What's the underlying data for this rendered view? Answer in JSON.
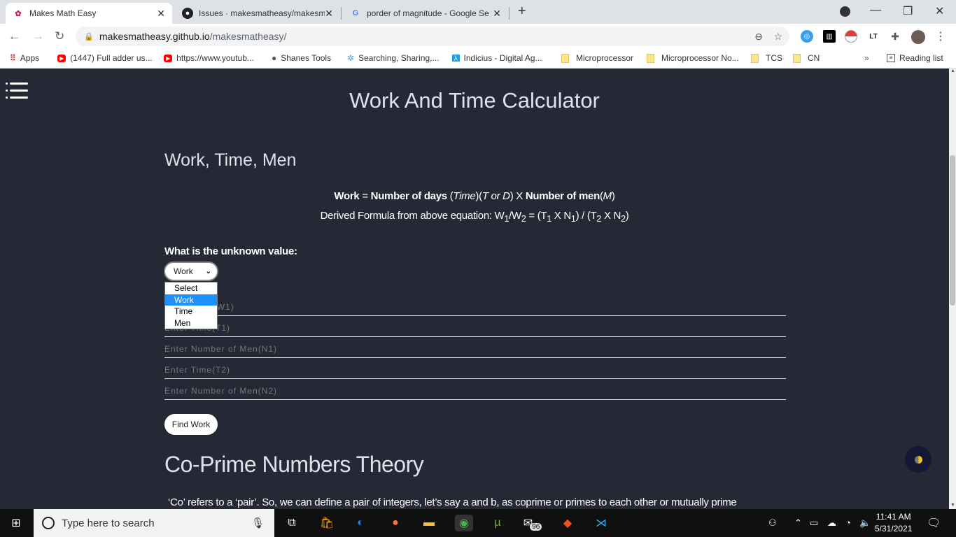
{
  "browser": {
    "tabs": [
      {
        "title": "Makes Math Easy",
        "active": true
      },
      {
        "title": "Issues · makesmatheasy/makesm"
      },
      {
        "title": "porder of magnitude - Google Se"
      }
    ],
    "url_host": "makesmatheasy.github.io",
    "url_path": "/makesmatheasy/",
    "bookmarks": [
      "Apps",
      "(1447) Full adder us...",
      "https://www.youtub...",
      "Shanes Tools",
      "Searching, Sharing,...",
      "Indicius - Digital Ag...",
      "Microprocessor",
      "Microprocessor No...",
      "TCS",
      "CN"
    ],
    "more_label": "»",
    "reading_list": "Reading list",
    "extensions": [
      "extension-blue-icon",
      "trash-icon",
      "pokeball-icon",
      "lt-icon",
      "puzzle-icon",
      "profile-avatar"
    ]
  },
  "page": {
    "title": "Work And Time Calculator",
    "section_title": "Work, Time, Men",
    "formula": {
      "work": "Work",
      "eq": " = ",
      "days": "Number of days",
      "open": " (",
      "time": "Time",
      "mid": ")(",
      "tord": "T or D",
      "x": ") X ",
      "men": "Number of men",
      "p1": "(",
      "m": "M",
      "p2": ")"
    },
    "derived": {
      "prefix": "Derived Formula from above equation: W",
      "s1": "1",
      "slash": "/W",
      "s2": "2",
      "rest1": " = (T",
      "s3": "1",
      "x1": " X N",
      "s4": "1",
      "rest2": ") / (T",
      "s5": "2",
      "x2": " X N",
      "s6": "2",
      "end": ")"
    },
    "question": "What is the unknown value:",
    "select_value": "Work",
    "options": [
      "Select",
      "Work",
      "Time",
      "Men"
    ],
    "fields": [
      {
        "placeholder": "Enter Work(W1)",
        "visible": "W1)"
      },
      {
        "placeholder": "Enter Time(T1)",
        "visible": "T1)"
      },
      {
        "placeholder": "Enter Number of Men(N1)"
      },
      {
        "placeholder": "Enter Time(T2)"
      },
      {
        "placeholder": "Enter Number of Men(N2)"
      }
    ],
    "button": "Find Work",
    "section2_title": "Co-Prime Numbers Theory",
    "paragraph": "‘Co’ refers to a ‘pair’. So, we can define a pair of integers, let’s say a and b, as coprime or primes to each other or mutually prime"
  },
  "taskbar": {
    "search_placeholder": "Type here to search",
    "mail_badge": "96",
    "time": "11:41 AM",
    "date": "5/31/2021"
  },
  "colors": {
    "page_bg": "#242935",
    "highlight": "#1e90ff"
  }
}
